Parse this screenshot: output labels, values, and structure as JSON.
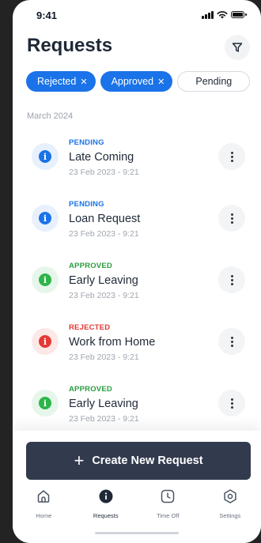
{
  "status_bar": {
    "time": "9:41"
  },
  "header": {
    "title": "Requests"
  },
  "filters": [
    {
      "label": "Rejected",
      "active": true
    },
    {
      "label": "Approved",
      "active": true
    },
    {
      "label": "Pending",
      "active": false
    }
  ],
  "section": {
    "label": "March 2024"
  },
  "requests": [
    {
      "status": "PENDING",
      "title": "Late Coming",
      "date": "23 Feb 2023 - 9:21"
    },
    {
      "status": "PENDING",
      "title": "Loan Request",
      "date": "23 Feb 2023 - 9:21"
    },
    {
      "status": "APPROVED",
      "title": "Early Leaving",
      "date": "23 Feb 2023 - 9:21"
    },
    {
      "status": "REJECTED",
      "title": "Work from Home",
      "date": "23 Feb 2023 - 9:21"
    },
    {
      "status": "APPROVED",
      "title": "Early Leaving",
      "date": "23 Feb 2023 - 9:21"
    }
  ],
  "actions": {
    "create_label": "Create New Request"
  },
  "tabs": [
    {
      "label": "Home",
      "icon": "home-icon"
    },
    {
      "label": "Requests",
      "icon": "info-icon",
      "active": true
    },
    {
      "label": "Time Off",
      "icon": "clock-icon"
    },
    {
      "label": "Settings",
      "icon": "gear-icon"
    }
  ],
  "colors": {
    "accent": "#1a73e8",
    "pending": "#1a73e8",
    "approved": "#2db54a",
    "rejected": "#e53935",
    "primary_button": "#323a4d"
  }
}
